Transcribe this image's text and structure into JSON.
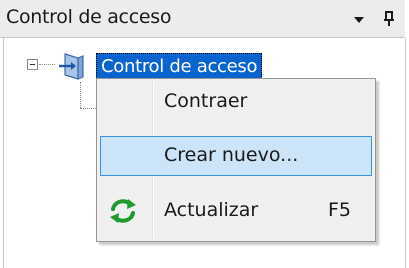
{
  "panel": {
    "title": "Control de acceso"
  },
  "tree": {
    "root": {
      "label": "Control de acceso",
      "expanded": true,
      "selected": true,
      "icon": "access-control-icon"
    }
  },
  "context_menu": {
    "items": [
      {
        "label": "Contraer",
        "shortcut": "",
        "icon": "",
        "highlighted": false
      },
      {
        "label": "Crear nuevo...",
        "shortcut": "",
        "icon": "",
        "highlighted": true
      },
      {
        "label": "Actualizar",
        "shortcut": "F5",
        "icon": "refresh-icon",
        "highlighted": false
      }
    ]
  },
  "colors": {
    "selection": "#0a64d0",
    "menu_highlight": "#cce4f7",
    "menu_highlight_border": "#3d8ee6",
    "refresh_green": "#1f9a2e"
  }
}
